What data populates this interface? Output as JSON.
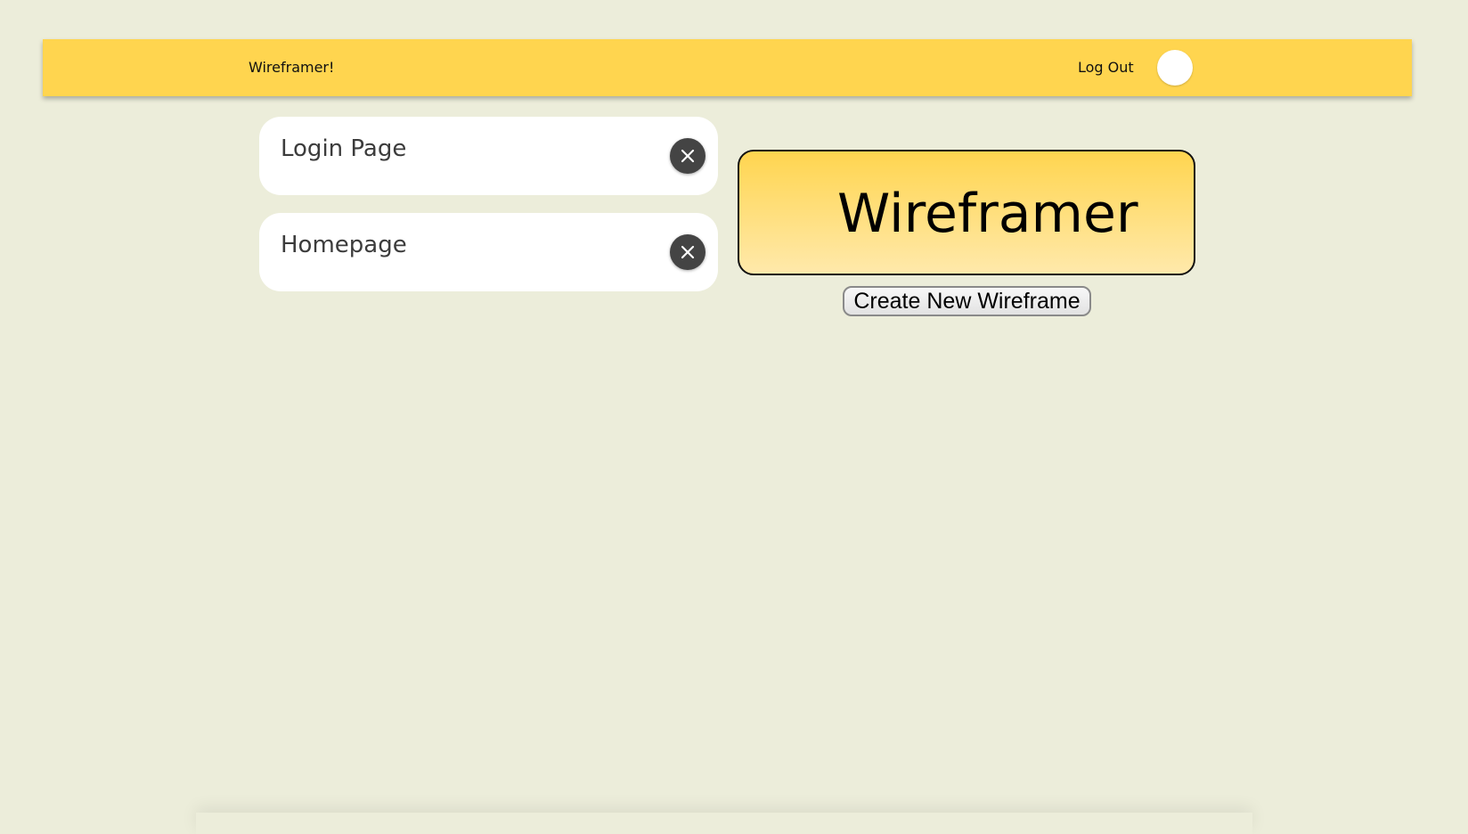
{
  "navbar": {
    "brand": "Wireframer!",
    "logout_label": "Log Out",
    "color": "#ffd54f"
  },
  "wireframes": [
    {
      "title": "Login Page",
      "delete_icon": "close-icon"
    },
    {
      "title": "Homepage",
      "delete_icon": "close-icon"
    }
  ],
  "banner": {
    "title": "Wireframer"
  },
  "create_button": {
    "label": "Create New Wireframe"
  },
  "colors": {
    "page_background": "#ecedda",
    "accent": "#ffd54f",
    "delete_button": "#444444"
  }
}
